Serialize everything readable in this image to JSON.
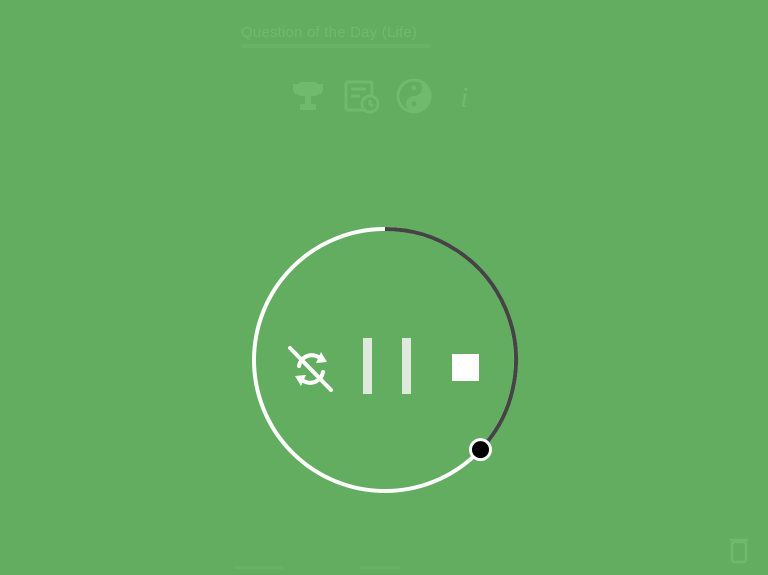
{
  "header": {
    "title": "Question of the Day (Life)"
  },
  "icons": {
    "trophy": "trophy-icon",
    "schedule": "schedule-icon",
    "yin_yang": "yin-yang-icon",
    "info": "info-icon",
    "info_glyph": "i"
  },
  "timer": {
    "progress": 0.37,
    "colors": {
      "remaining": "#ffffff",
      "elapsed": "#444444",
      "knob": "#000000"
    },
    "controls": {
      "repeat_off": "repeat-off-icon",
      "pause": "pause-icon",
      "stop": "stop-icon"
    }
  },
  "colors": {
    "background": "#62ad5f"
  }
}
